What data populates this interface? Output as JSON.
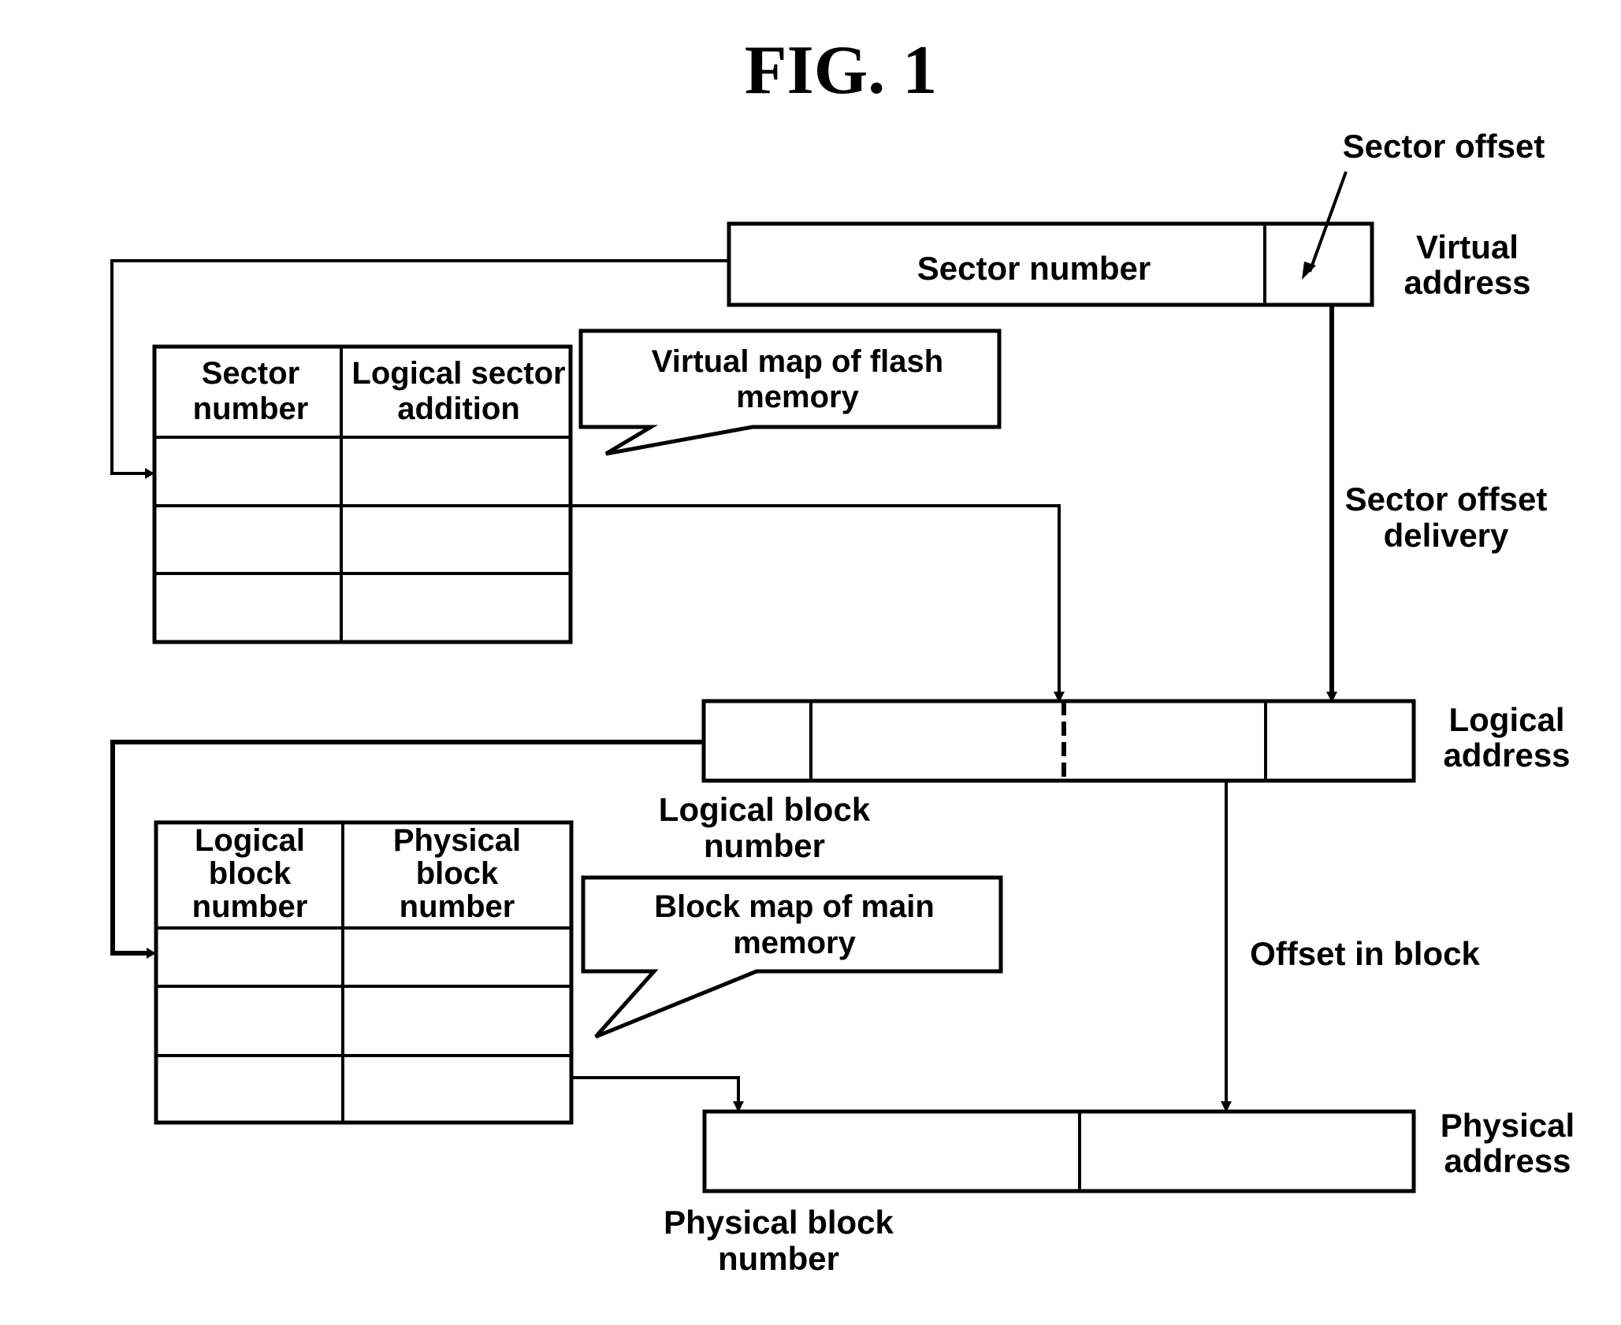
{
  "figure": {
    "title": "FIG. 1"
  },
  "virtual_address": {
    "label_line1": "Virtual",
    "label_line2": "address",
    "field_sector_number": "Sector number",
    "sector_offset_label": "Sector offset"
  },
  "sector_offset_delivery": {
    "line1": "Sector offset",
    "line2": "delivery"
  },
  "virtual_map_table": {
    "headers": [
      {
        "line1": "Sector",
        "line2": "number"
      },
      {
        "line1": "Logical sector",
        "line2": "addition"
      }
    ],
    "rows": [
      [
        "",
        ""
      ],
      [
        "",
        ""
      ],
      [
        "",
        ""
      ]
    ]
  },
  "virtual_map_callout": {
    "line1": "Virtual map of flash",
    "line2": "memory"
  },
  "logical_address": {
    "label_line1": "Logical",
    "label_line2": "address",
    "logical_block_number_line1": "Logical block",
    "logical_block_number_line2": "number"
  },
  "block_map_table": {
    "headers": [
      {
        "line1": "Logical",
        "line2": "block",
        "line3": "number"
      },
      {
        "line1": "Physical",
        "line2": "block",
        "line3": "number"
      }
    ],
    "rows": [
      [
        "",
        ""
      ],
      [
        "",
        ""
      ],
      [
        "",
        ""
      ]
    ]
  },
  "block_map_callout": {
    "line1": "Block map of main",
    "line2": "memory"
  },
  "offset_in_block": {
    "label": "Offset in block"
  },
  "physical_address": {
    "label_line1": "Physical",
    "label_line2": "address",
    "physical_block_number_line1": "Physical block",
    "physical_block_number_line2": "number"
  }
}
